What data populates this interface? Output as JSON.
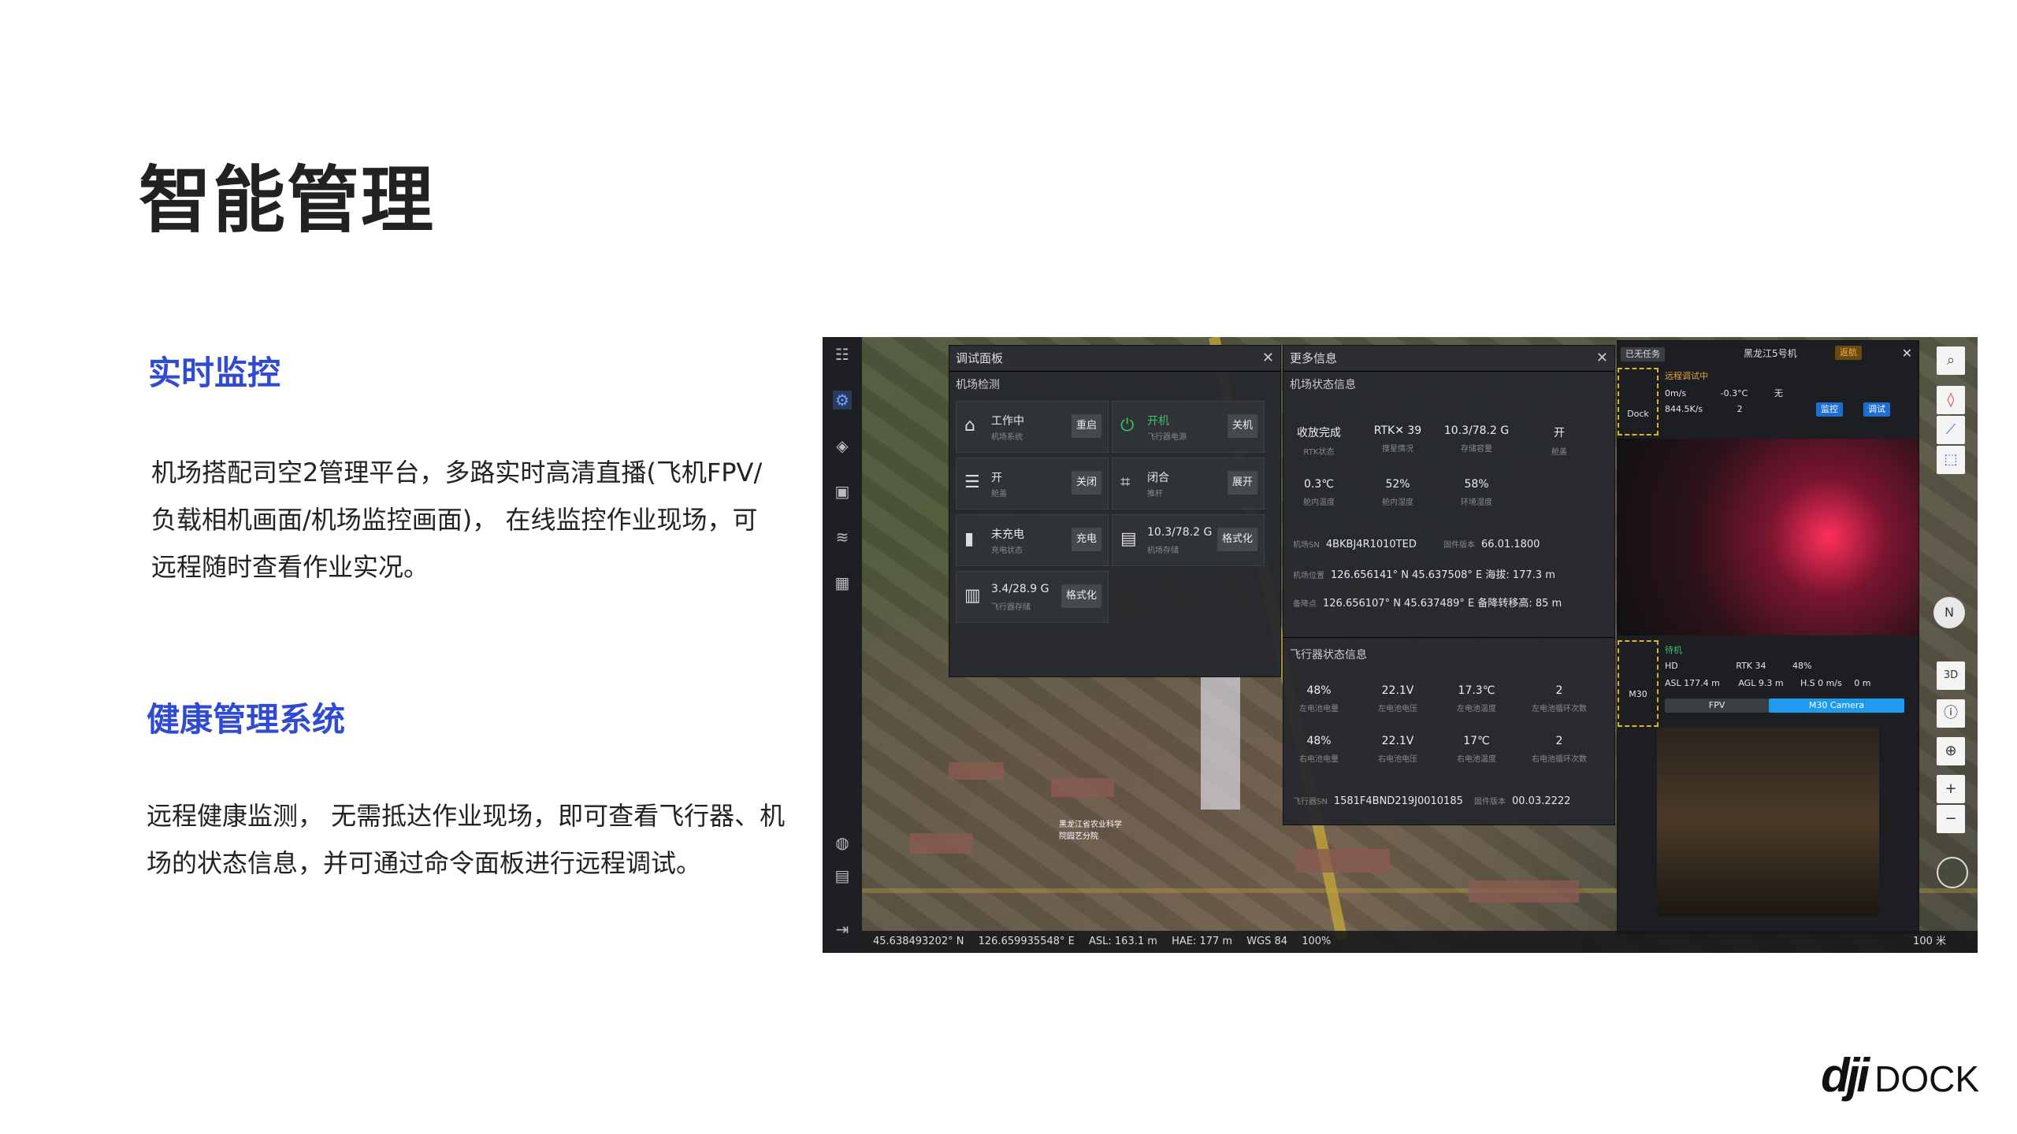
{
  "page": {
    "title": "智能管理",
    "section1": {
      "heading": "实时监控",
      "lines": [
        "机场搭配司空2管理平台，多路实时高清直播(飞机FPV/",
        "负载相机画面/机场监控画面)，  在线监控作业现场，可",
        "远程随时查看作业实况。"
      ]
    },
    "section2": {
      "heading": "健康管理系统",
      "lines": [
        "远程健康监测，  无需抵达作业现场，即可查看飞行器、机",
        "场的状态信息，并可通过命令面板进行远程调试。"
      ]
    },
    "logo": {
      "mark": "dji",
      "text": "DOCK"
    }
  },
  "screenshot": {
    "debug_panel": {
      "title": "调试面板",
      "section": "机场检测",
      "cells": [
        {
          "icon": "dock-system-icon",
          "label": "工作中",
          "sub": "机场系统",
          "button": "重启"
        },
        {
          "icon": "power-icon",
          "label": "开机",
          "sub": "飞行器电源",
          "button": "关机",
          "accent": "#3cc26a"
        },
        {
          "icon": "hatch-icon",
          "label": "开",
          "sub": "舱盖",
          "button": "关闭"
        },
        {
          "icon": "putter-icon",
          "label": "闭合",
          "sub": "推杆",
          "button": "展开"
        },
        {
          "icon": "battery-icon",
          "label": "未充电",
          "sub": "充电状态",
          "button": "充电"
        },
        {
          "icon": "storage-icon",
          "label": "10.3/78.2 G",
          "sub": "机场存储",
          "button": "格式化"
        },
        {
          "icon": "aircraft-storage-icon",
          "label": "3.4/28.9 G",
          "sub": "飞行器存储",
          "button": "格式化"
        }
      ]
    },
    "more_panel": {
      "title": "更多信息",
      "dock_section": "机场状态信息",
      "dock_kv_row1": [
        {
          "v": "收放完成",
          "k": "RTK状态"
        },
        {
          "v": "RTK✕ 39",
          "k": "搜星情况"
        },
        {
          "v": "10.3/78.2 G",
          "k": "存储容量"
        },
        {
          "v": "开",
          "k": "舱盖"
        }
      ],
      "dock_kv_row2": [
        {
          "v": "0.3℃",
          "k": "舱内温度"
        },
        {
          "v": "52%",
          "k": "舱内湿度"
        },
        {
          "v": "58%",
          "k": "环境湿度"
        }
      ],
      "dock_rows": [
        {
          "k": "机场SN",
          "v": "4BKBJ4R1010TED",
          "k2": "固件版本",
          "v2": "66.01.1800"
        },
        {
          "k": "机场位置",
          "v": "126.656141° N  45.637508° E  海拔: 177.3 m"
        },
        {
          "k": "备降点",
          "v": "126.656107° N  45.637489° E  备降转移高: 85 m"
        }
      ],
      "aircraft_section": "飞行器状态信息",
      "aircraft_kv_row1": [
        {
          "v": "48%",
          "k": "左电池电量"
        },
        {
          "v": "22.1V",
          "k": "左电池电压"
        },
        {
          "v": "17.3℃",
          "k": "左电池温度"
        },
        {
          "v": "2",
          "k": "左电池循环次数"
        }
      ],
      "aircraft_kv_row2": [
        {
          "v": "48%",
          "k": "右电池电量"
        },
        {
          "v": "22.1V",
          "k": "右电池电压"
        },
        {
          "v": "17℃",
          "k": "右电池温度"
        },
        {
          "v": "2",
          "k": "右电池循环次数"
        }
      ],
      "aircraft_sn": {
        "k": "飞行器SN",
        "v": "1581F4BND219J0010185",
        "k2": "固件版本",
        "v2": "00.03.2222"
      }
    },
    "video_panel": {
      "header_tag": "已无任务",
      "device_name": "黑龙江5号机",
      "return_btn": "返航",
      "dock_label": "Dock",
      "dock_status": "远程调试中",
      "dock_stats": [
        "0m/s",
        "-0.3°C",
        "无",
        "844.5K/s",
        "2"
      ],
      "monitor_btn": "监控",
      "debug_btn": "调试",
      "drone_label": "M30",
      "drone_status": "待机",
      "drone_stats": [
        "HD",
        "RTK 34",
        "48%",
        "ASL 177.4 m",
        "AGL 9.3 m",
        "H.S 0 m/s",
        "0 m"
      ],
      "fpv_btn": "FPV",
      "camera_btn": "M30 Camera"
    },
    "map_label": "黑龙江省农业科学院园艺分院",
    "statusbar": [
      "45.638493202° N",
      "126.659935548° E",
      "ASL: 163.1 m",
      "HAE: 177 m",
      "WGS 84",
      "100%"
    ],
    "scale": "100 米",
    "right_tools": [
      "search-icon",
      "pin-icon",
      "line-icon",
      "area-icon"
    ],
    "right_tools2": [
      "3D",
      "compass",
      "locate",
      "+",
      "−"
    ]
  }
}
